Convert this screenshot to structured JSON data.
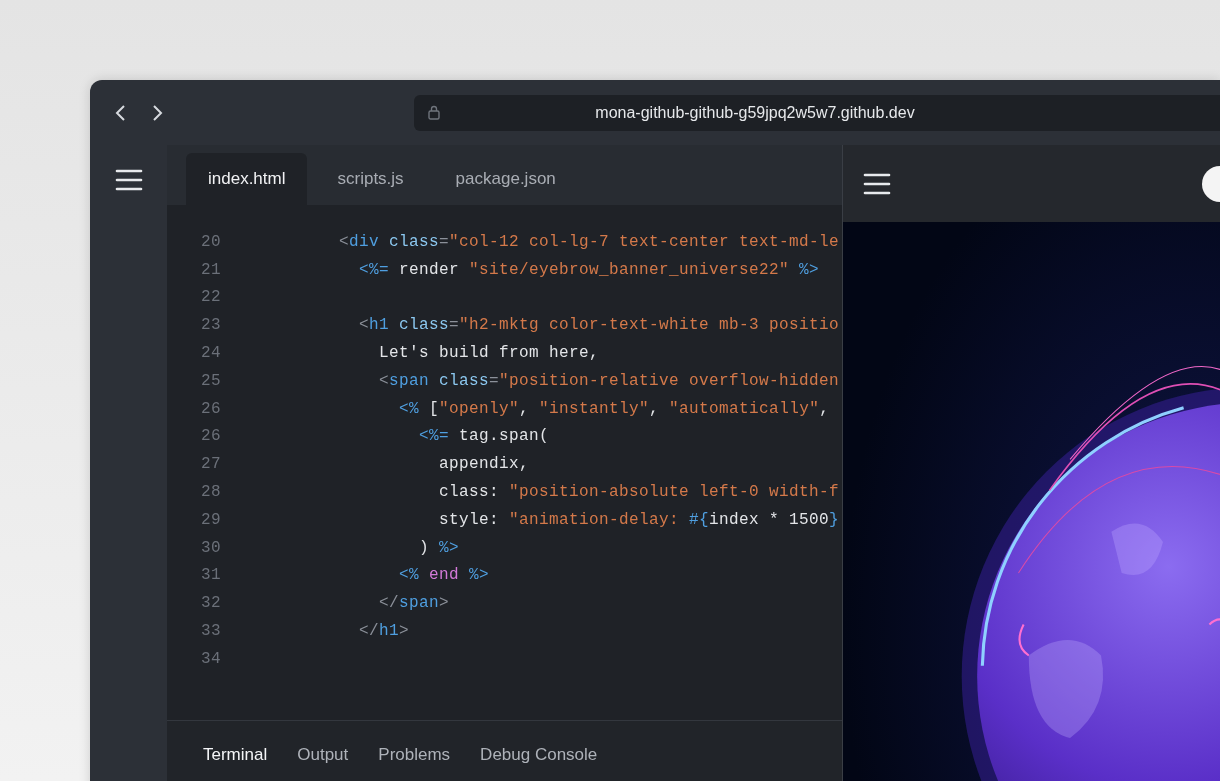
{
  "browser": {
    "url": "mona-github-github-g59jpq2w5w7.github.dev"
  },
  "editor": {
    "tabs": [
      {
        "label": "index.html",
        "selected": true
      },
      {
        "label": "scripts.js",
        "selected": false
      },
      {
        "label": "package.json",
        "selected": false
      }
    ],
    "lines": [
      {
        "number": "20",
        "tokens": [
          {
            "kind": "punct",
            "text": "<"
          },
          {
            "kind": "tag",
            "text": "div"
          },
          {
            "kind": "attr",
            "text": " class"
          },
          {
            "kind": "punct",
            "text": "="
          },
          {
            "kind": "string",
            "text": "\"col-12 col-lg-7 text-center text-md-le"
          }
        ]
      },
      {
        "number": "21",
        "tokens": [
          {
            "kind": "erb",
            "text": "  <%="
          },
          {
            "kind": "plain",
            "text": " render "
          },
          {
            "kind": "string",
            "text": "\"site/eyebrow_banner_universe22\""
          },
          {
            "kind": "erb",
            "text": " %>"
          }
        ]
      },
      {
        "number": "22"
      },
      {
        "number": "23",
        "tokens": [
          {
            "kind": "punct",
            "text": "  <"
          },
          {
            "kind": "tag",
            "text": "h1"
          },
          {
            "kind": "attr",
            "text": " class"
          },
          {
            "kind": "punct",
            "text": "="
          },
          {
            "kind": "string",
            "text": "\"h2-mktg color-text-white mb-3 positio"
          }
        ]
      },
      {
        "number": "24",
        "tokens": [
          {
            "kind": "plain",
            "text": "    Let's build from here,"
          }
        ]
      },
      {
        "number": "25",
        "tokens": [
          {
            "kind": "punct",
            "text": "    <"
          },
          {
            "kind": "tag",
            "text": "span"
          },
          {
            "kind": "attr",
            "text": " class"
          },
          {
            "kind": "punct",
            "text": "="
          },
          {
            "kind": "string",
            "text": "\"position-relative overflow-hidden"
          }
        ]
      },
      {
        "number": "26",
        "tokens": [
          {
            "kind": "erb",
            "text": "      <%"
          },
          {
            "kind": "plain",
            "text": " ["
          },
          {
            "kind": "string",
            "text": "\"openly\""
          },
          {
            "kind": "plain",
            "text": ", "
          },
          {
            "kind": "string",
            "text": "\"instantly\""
          },
          {
            "kind": "plain",
            "text": ", "
          },
          {
            "kind": "string",
            "text": "\"automatically\""
          },
          {
            "kind": "plain",
            "text": ","
          }
        ]
      },
      {
        "number": "26",
        "tokens": [
          {
            "kind": "erb",
            "text": "        <%="
          },
          {
            "kind": "plain",
            "text": " tag.span("
          }
        ]
      },
      {
        "number": "27",
        "tokens": [
          {
            "kind": "plain",
            "text": "          appendix,"
          }
        ]
      },
      {
        "number": "28",
        "tokens": [
          {
            "kind": "plain",
            "text": "          class: "
          },
          {
            "kind": "string",
            "text": "\"position-absolute left-0 width-f"
          }
        ]
      },
      {
        "number": "29",
        "tokens": [
          {
            "kind": "plain",
            "text": "          style: "
          },
          {
            "kind": "string",
            "text": "\"animation-delay: "
          },
          {
            "kind": "erb",
            "text": "#{"
          },
          {
            "kind": "plain",
            "text": "index * 1500"
          },
          {
            "kind": "erb",
            "text": "}"
          }
        ]
      },
      {
        "number": "30",
        "tokens": [
          {
            "kind": "plain",
            "text": "        ) "
          },
          {
            "kind": "erb",
            "text": "%>"
          }
        ]
      },
      {
        "number": "31",
        "tokens": [
          {
            "kind": "erb",
            "text": "      <%"
          },
          {
            "kind": "keyword",
            "text": " end"
          },
          {
            "kind": "erb",
            "text": " %>"
          }
        ]
      },
      {
        "number": "32",
        "tokens": [
          {
            "kind": "punct",
            "text": "    </"
          },
          {
            "kind": "tag",
            "text": "span"
          },
          {
            "kind": "punct",
            "text": ">"
          }
        ]
      },
      {
        "number": "33",
        "tokens": [
          {
            "kind": "punct",
            "text": "  </"
          },
          {
            "kind": "tag",
            "text": "h1"
          },
          {
            "kind": "punct",
            "text": ">"
          }
        ]
      },
      {
        "number": "34"
      }
    ]
  },
  "panel": {
    "tabs": [
      {
        "label": "Terminal",
        "selected": true
      },
      {
        "label": "Output",
        "selected": false
      },
      {
        "label": "Problems",
        "selected": false
      },
      {
        "label": "Debug Console",
        "selected": false
      }
    ]
  }
}
